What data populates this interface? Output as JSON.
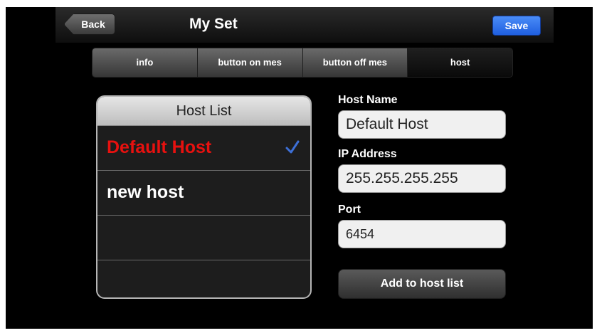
{
  "navbar": {
    "back_label": "Back",
    "title": "My Set",
    "save_label": "Save"
  },
  "tabs": [
    {
      "label": "info",
      "active": false
    },
    {
      "label": "button on mes",
      "active": false
    },
    {
      "label": "button off mes",
      "active": false
    },
    {
      "label": "host",
      "active": true
    }
  ],
  "host_list": {
    "header": "Host List",
    "rows": [
      {
        "name": "Default Host",
        "selected": true
      },
      {
        "name": "new host",
        "selected": false
      },
      {
        "name": "",
        "selected": false
      },
      {
        "name": "",
        "selected": false
      }
    ]
  },
  "form": {
    "host_name_label": "Host Name",
    "host_name_value": "Default Host",
    "ip_label": "IP Address",
    "ip_value": "255.255.255.255",
    "port_label": "Port",
    "port_value": "6454",
    "add_button_label": "Add to host list"
  },
  "colors": {
    "selected_host": "#e8110f",
    "checkmark": "#3d6fd6",
    "save_button": "#2a6ef0"
  },
  "icons": {
    "selected_row": "checkmark-icon"
  }
}
